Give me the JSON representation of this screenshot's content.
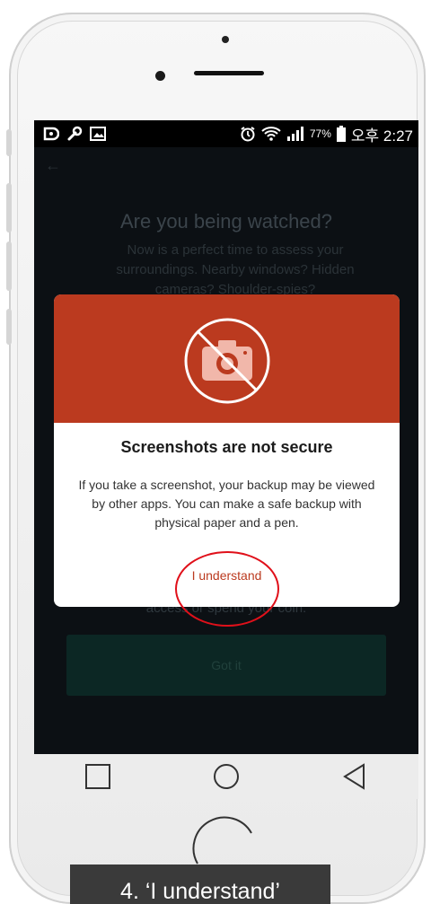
{
  "status_bar": {
    "battery_percent": "77%",
    "time": "오후 2:27",
    "left_icons": [
      "app-icon",
      "wrench-icon",
      "image-icon"
    ],
    "right_icons": [
      "alarm-icon",
      "wifi-icon",
      "signal-icon",
      "battery-icon"
    ]
  },
  "background_screen": {
    "title": "Are you being watched?",
    "description": "Now is a perfect time to assess your surroundings. Nearby windows? Hidden cameras? Shoulder-spies?",
    "access_text": "access or spend your coin.",
    "got_it_label": "Got it"
  },
  "dialog": {
    "header_icon": "no-camera-icon",
    "header_color": "#bb3a1f",
    "title": "Screenshots are not secure",
    "message": "If you take a screenshot, your backup may be viewed by other apps. You can make a safe backup with physical paper and a pen.",
    "action_label": "I understand"
  },
  "nav_bar": {
    "buttons": [
      "recent-apps-icon",
      "home-icon",
      "back-icon"
    ]
  },
  "caption": {
    "text": "4. ‘I understand’"
  }
}
